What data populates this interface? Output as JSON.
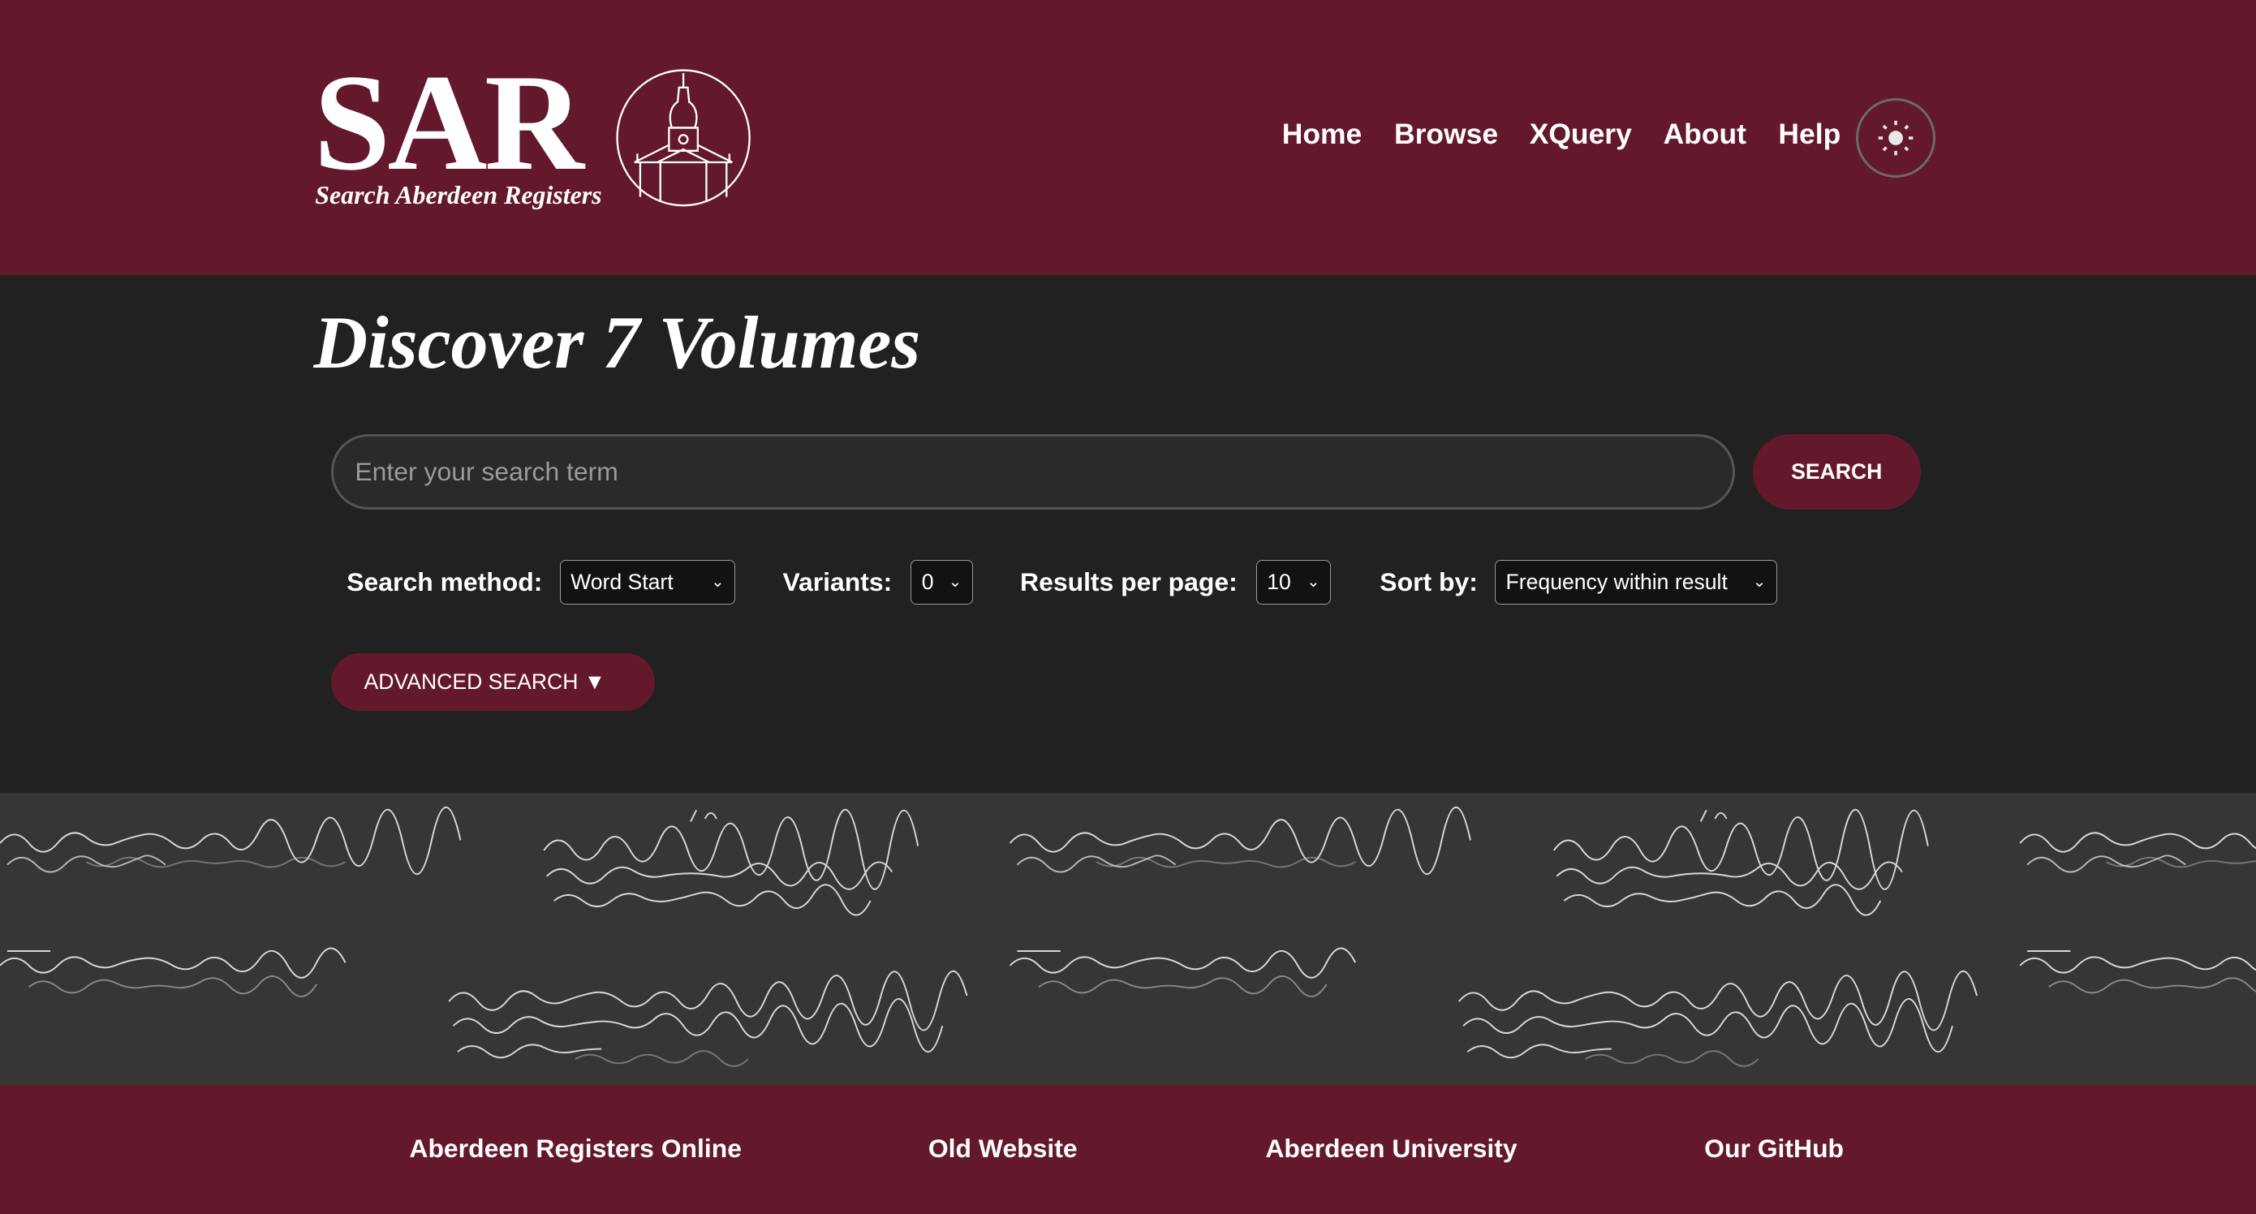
{
  "header": {
    "logo_text": "SAR",
    "logo_subtitle": "Search Aberdeen Registers",
    "nav": [
      "Home",
      "Browse",
      "XQuery",
      "About",
      "Help"
    ],
    "theme_toggle_icon": "sun-icon"
  },
  "main": {
    "title": "Discover 7 Volumes",
    "search_placeholder": "Enter your search term",
    "search_value": "",
    "search_button": "SEARCH",
    "options": {
      "method_label": "Search method:",
      "method_value": "Word Start",
      "variants_label": "Variants:",
      "variants_value": "0",
      "per_page_label": "Results per page:",
      "per_page_value": "10",
      "sort_label": "Sort by:",
      "sort_value": "Frequency within result"
    },
    "advanced_button": "ADVANCED SEARCH ▼"
  },
  "footer": {
    "links": [
      "Aberdeen Registers Online",
      "Old Website",
      "Aberdeen University",
      "Our GitHub"
    ]
  },
  "colors": {
    "brand": "#63192b",
    "background": "#212121"
  }
}
